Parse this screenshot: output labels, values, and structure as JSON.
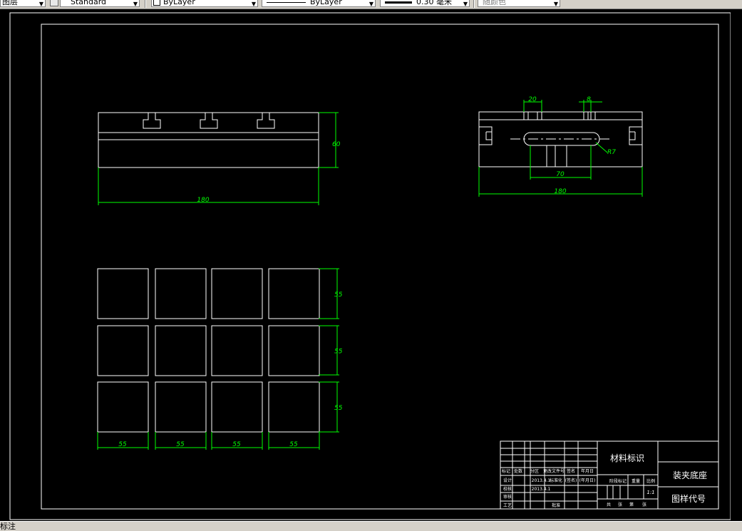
{
  "toolbar": {
    "layer_label": "图层",
    "text_style": "Standard",
    "color_value": "ByLayer",
    "linetype_value": "ByLayer",
    "lineweight_value": "0.30 毫米",
    "plotstyle_value": "随颜色"
  },
  "status": {
    "text": "标注"
  },
  "drawing": {
    "front_view": {
      "height_dim": "60",
      "width_dim": "180"
    },
    "side_view": {
      "dim_top_left": "20",
      "dim_top_right": "8",
      "dim_radius": "R7",
      "dim_slot": "70",
      "dim_width": "180"
    },
    "top_view": {
      "row_dims": [
        "55",
        "55",
        "55"
      ],
      "col_dims": [
        "55",
        "55",
        "55",
        "55"
      ]
    }
  },
  "title_block": {
    "material": "材料标识",
    "part_name": "装夹底座",
    "drawing_code": "图样代号",
    "header_cells": [
      "标记",
      "处数",
      "分区",
      "更改文件号",
      "签名",
      "年月日"
    ],
    "designer_row": [
      "设计",
      "2013.4.1",
      "标准化",
      "(签名)",
      "(年月日)"
    ],
    "checker_row": [
      "校核",
      "2013.4.1"
    ],
    "approver_row": [
      "审核"
    ],
    "process_row": [
      "工艺",
      "批准"
    ],
    "stage_label": "阶段标记",
    "weight_label": "重量",
    "scale_label": "比例",
    "scale_value": "1:1",
    "sheet_cells": [
      "共",
      "张",
      "第",
      "张"
    ]
  }
}
